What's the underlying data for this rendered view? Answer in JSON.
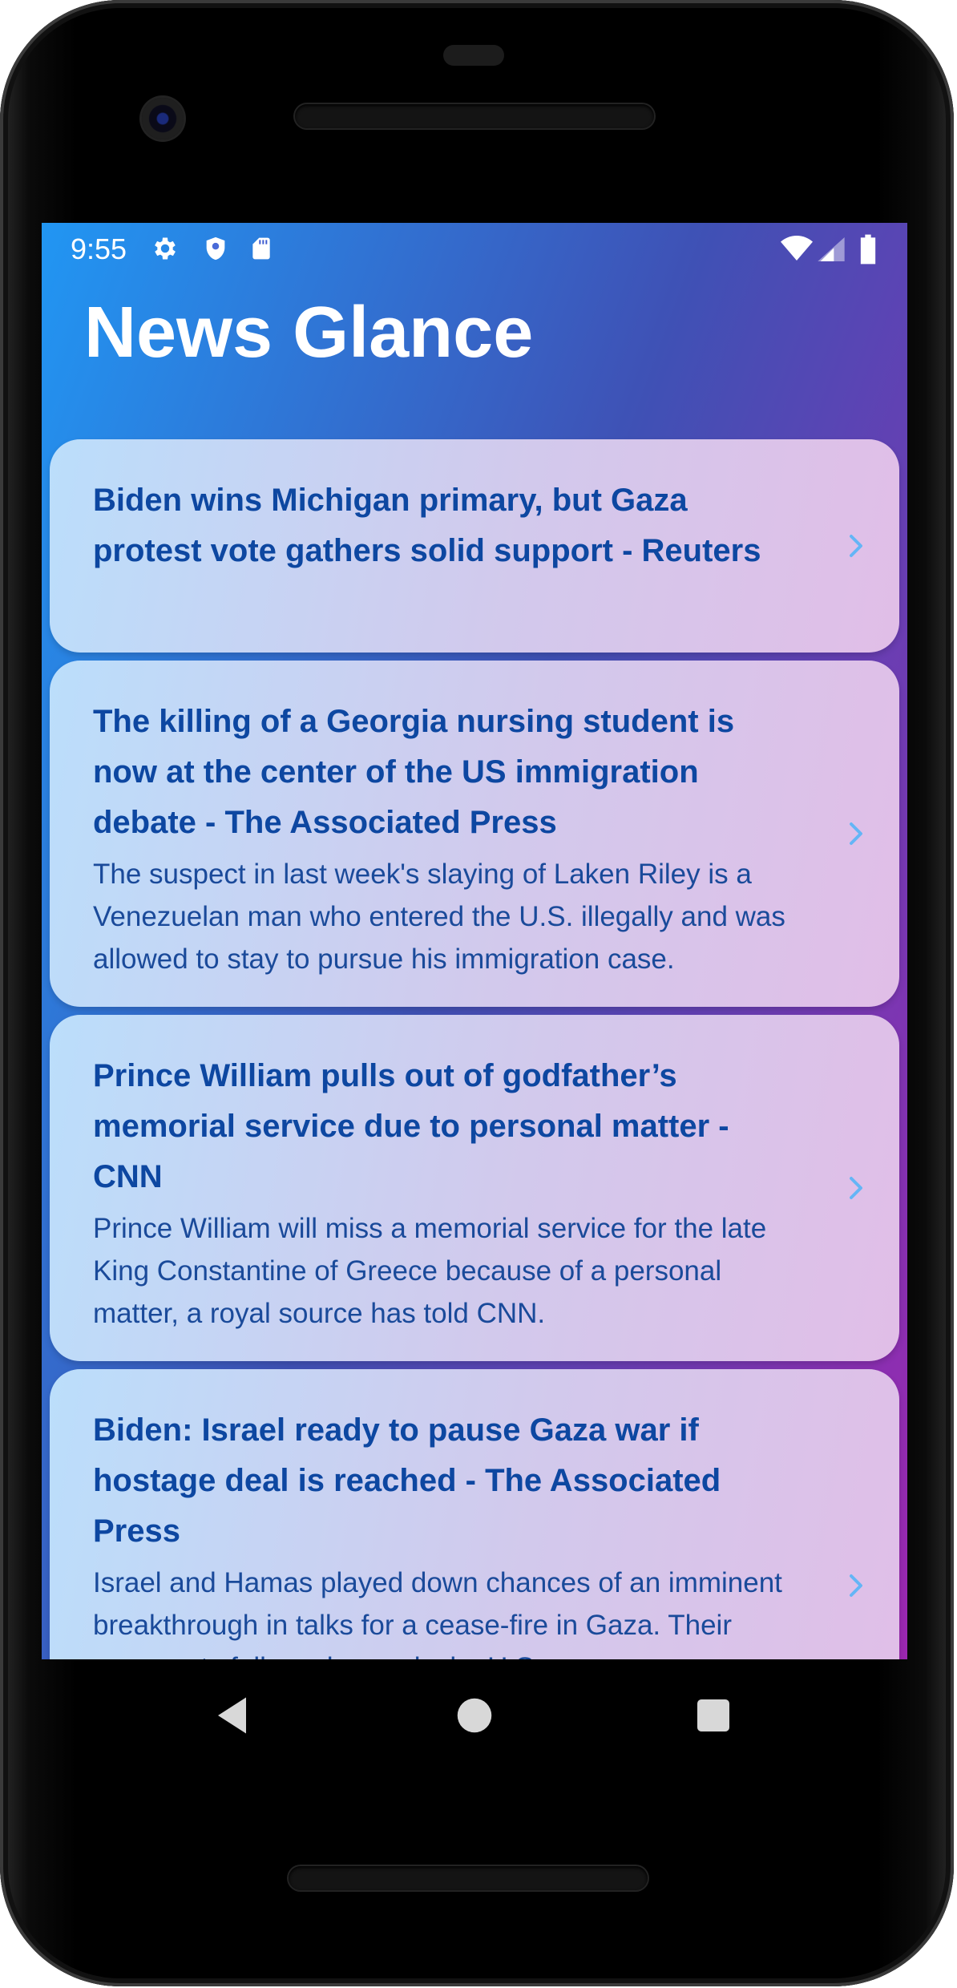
{
  "status_bar": {
    "time": "9:55",
    "left_icons": [
      "gear-icon",
      "shield-icon",
      "sd-card-icon"
    ],
    "right_icons": [
      "wifi-icon",
      "signal-icon",
      "battery-icon"
    ]
  },
  "app": {
    "title": "News Glance",
    "gradient": [
      "#2196F3",
      "#3F51B5",
      "#9C27B0"
    ]
  },
  "articles": [
    {
      "title": "Biden wins Michigan primary, but Gaza protest vote gathers solid support - Reuters",
      "description": ""
    },
    {
      "title": "The killing of a Georgia nursing student is now at the center of the US immigration debate - The Associated Press",
      "description": "The suspect in last week's slaying of Laken Riley is a Venezuelan man who entered the U.S. illegally and was allowed to stay to pursue his immigration case."
    },
    {
      "title": "Prince William pulls out of godfather’s memorial service due to personal matter - CNN",
      "description": "Prince William will miss a memorial service for the late King Constantine of Greece because of a personal matter, a royal source has told CNN."
    },
    {
      "title": "Biden: Israel ready to pause Gaza war if hostage deal is reached - The Associated Press",
      "description": "Israel and Hamas played down chances of an imminent breakthrough in talks for a cease-fire in Gaza. Their comments followed remarks by U.S."
    }
  ],
  "nav_bar": {
    "buttons": [
      "back-icon",
      "home-icon",
      "recents-icon"
    ]
  },
  "colors": {
    "card_text": "#0D47A1",
    "chevron": "#64B5F6"
  }
}
